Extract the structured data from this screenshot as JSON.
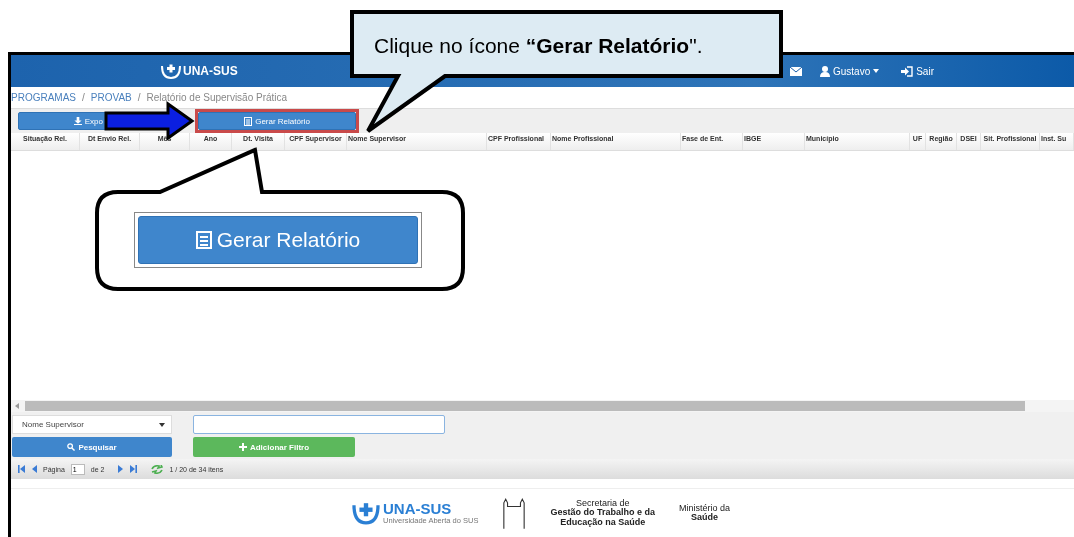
{
  "instruction_callout": {
    "text": "Clique no ícone **“Gerar Relatório**\"."
  },
  "header": {
    "logo": "UNA-SUS",
    "user": "Gustavo",
    "logout": "Sair"
  },
  "breadcrumb": {
    "separator": "/",
    "items": [
      {
        "label": "PROGRAMAS",
        "kind": "link"
      },
      {
        "label": "PROVAB",
        "kind": "link"
      },
      {
        "label": "Relatório de Supervisão Prática",
        "kind": "current"
      }
    ]
  },
  "toolbar": {
    "buttons": [
      {
        "label": "Expo",
        "kind": "export",
        "highlighted": false
      },
      {
        "label": "Gerar Relatório",
        "kind": "report",
        "highlighted": true
      }
    ]
  },
  "table": {
    "columns": [
      "Situação Rel.",
      "Dt Envio Rel.",
      "Mês",
      "Ano",
      "Dt. Visita",
      "CPF Supervisor",
      "Nome Supervisor",
      "CPF Profissional",
      "Nome Profissional",
      "Fase de Ent.",
      "IBGE",
      "Município",
      "UF",
      "Região",
      "DSEI",
      "Sit. Profissional",
      "Inst. Su"
    ]
  },
  "filter": {
    "field": "Nome Supervisor",
    "search_button": "Pesquisar",
    "add_button": "Adicionar Filtro"
  },
  "pager": {
    "label": "Página",
    "page": "1",
    "of": "de 2",
    "summary": "1 / 20 de 34 itens"
  },
  "zoom_callout": {
    "button_label": "Gerar Relatório"
  },
  "footer": {
    "logo": "UNA-SUS",
    "logo_caption": "Universidade Aberta do SUS",
    "secretaria": [
      "Secretaria de",
      "Gestão do Trabalho e da",
      "Educação na Saúde"
    ],
    "ministerio": [
      "Ministério da",
      "Saúde"
    ]
  }
}
